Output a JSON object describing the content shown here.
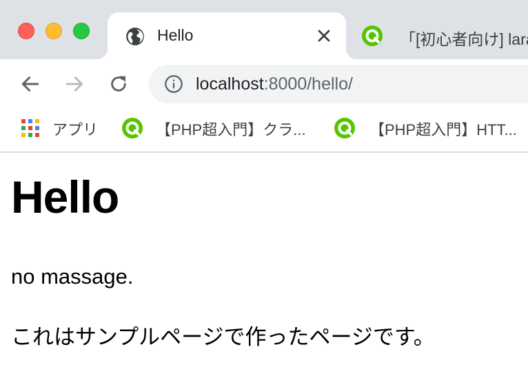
{
  "tabs": [
    {
      "title": "Hello",
      "active": true,
      "icon": "globe-icon"
    },
    {
      "title": "「[初心者向け] lara",
      "active": false,
      "icon": "qiita-icon"
    }
  ],
  "toolbar": {
    "back_icon": "back-arrow-icon",
    "forward_icon": "forward-arrow-icon",
    "reload_icon": "reload-icon",
    "address": {
      "host": "localhost",
      "rest": ":8000/hello/",
      "info_icon": "info-icon"
    }
  },
  "bookmarks": {
    "apps_label": "アプリ",
    "items": [
      {
        "label": "【PHP超入門】クラ...",
        "icon": "qiita-icon"
      },
      {
        "label": "【PHP超入門】HTT...",
        "icon": "qiita-icon"
      }
    ]
  },
  "page": {
    "heading": "Hello",
    "message": "no massage.",
    "text": "これはサンプルページで作ったページです。"
  },
  "colors": {
    "tabstrip_bg": "#dee1e6",
    "omnibox_bg": "#f1f3f4",
    "traffic_close": "#fe5f57",
    "traffic_minimize": "#febc2e",
    "traffic_maximize": "#28c840",
    "qiita_green": "#55c500"
  }
}
